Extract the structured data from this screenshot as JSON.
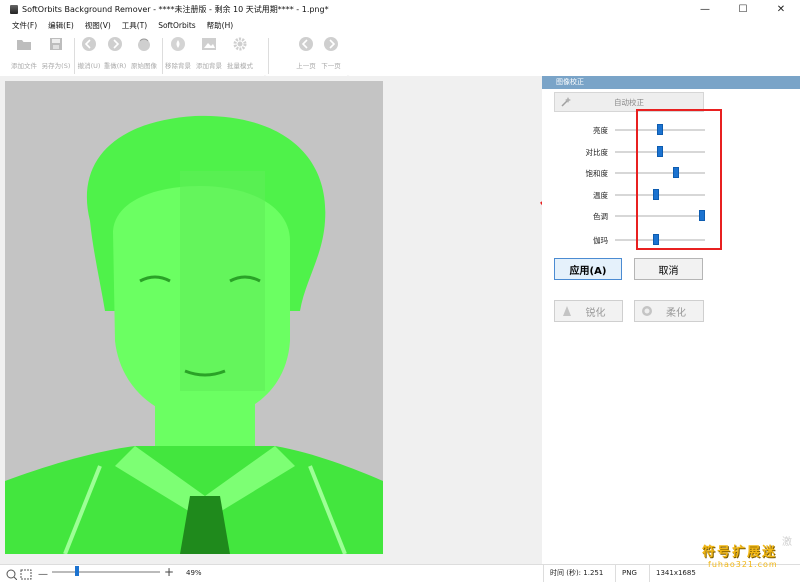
{
  "window": {
    "title": "SoftOrbits Background Remover - ****未注册版 - 剩余 10 天试用期**** - 1.png*",
    "controls": {
      "minimize": "—",
      "maximize": "☐",
      "close": "✕"
    }
  },
  "menu": {
    "items": [
      "文件(F)",
      "编辑(E)",
      "视图(V)",
      "工具(T)",
      "SoftOrbits",
      "帮助(H)"
    ]
  },
  "toolbar": {
    "add_file": "添加文件",
    "save_as": "另存为(S)",
    "undo": "撤消(U)",
    "redo": "重做(R)",
    "original_image": "原始图像",
    "remove_bg": "移除背景",
    "add_bg": "添加背景",
    "batch_mode": "批量模式",
    "prev_page": "上一页",
    "next_page": "下一页"
  },
  "panel": {
    "header": "图像校正",
    "auto_correct": "自动校正",
    "sliders": [
      {
        "label": "亮度",
        "value": 0.5
      },
      {
        "label": "对比度",
        "value": 0.5
      },
      {
        "label": "饱和度",
        "value": 0.69
      },
      {
        "label": "温度",
        "value": 0.45
      },
      {
        "label": "色调",
        "value": 1.0
      },
      {
        "label": "伽玛",
        "value": 0.45
      }
    ],
    "apply": "应用(A)",
    "cancel": "取消",
    "sharpen": "锐化",
    "soften": "柔化"
  },
  "status": {
    "zoom": "49%",
    "zoom_level": 0.22,
    "time": "时间 (秒): 1.251",
    "format": "PNG",
    "dimensions": "1341x1685"
  },
  "watermark": {
    "main": "符号扩展迷",
    "sub": "fuhao321.com",
    "faint": "激"
  },
  "colors": {
    "accent": "#1c73d0",
    "panel_header": "#7aa4c8",
    "highlight_box": "#e82020",
    "overlay_green": "#5dff55",
    "watermark": "#f2b714"
  }
}
